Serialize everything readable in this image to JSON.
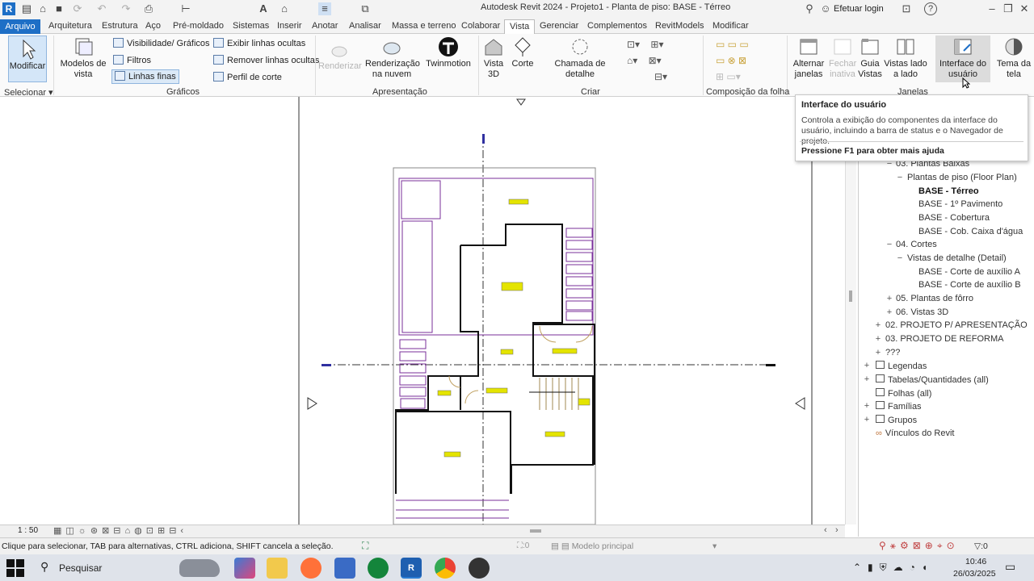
{
  "window": {
    "title": "Autodesk Revit 2024 - Projeto1 - Planta de piso: BASE - Térreo",
    "login": "Efetuar login",
    "help": "?"
  },
  "tabs": [
    "Arquivo",
    "Arquitetura",
    "Estrutura",
    "Aço",
    "Pré-moldado",
    "Sistemas",
    "Inserir",
    "Anotar",
    "Analisar",
    "Massa e terreno",
    "Colaborar",
    "Vista",
    "Gerenciar",
    "Complementos",
    "RevitModels",
    "Modificar"
  ],
  "ribbon": {
    "modify": "Modificar",
    "view_templates": "Modelos de vista",
    "visibility": "Visibilidade/ Gráficos",
    "filters": "Filtros",
    "thin_lines": "Linhas finas",
    "show_hidden": "Exibir linhas ocultas",
    "remove_hidden": "Remover linhas ocultas",
    "cut_profile": "Perfil de corte",
    "render": "Renderizar",
    "cloud_render": "Renderização na nuvem",
    "twinmotion": "Twinmotion",
    "view3d": "Vista 3D",
    "section": "Corte",
    "detail_callout": "Chamada de detalhe",
    "switch_windows": "Alternar janelas",
    "close_inactive": "Fechar inativa",
    "tab_views": "Guia Vistas",
    "tile_views": "Vistas lado a lado",
    "user_interface": "Interface do usuário",
    "screen_theme": "Tema da tela",
    "panels": {
      "select": "Selecionar",
      "graphics": "Gráficos",
      "presentation": "Apresentação",
      "create": "Criar",
      "sheet_composition": "Composição da folha",
      "windows": "Janelas"
    }
  },
  "tooltip": {
    "title": "Interface do usuário",
    "body": "Controla a exibição do componentes da interface do usuário, incluindo a barra de status e o Navegador de projeto.",
    "help": "Pressione F1 para obter mais ajuda"
  },
  "browser": {
    "items": [
      {
        "label": "03. Plantas Baixas",
        "toggle": "−"
      },
      {
        "label": "Plantas de piso (Floor Plan)",
        "toggle": "−"
      },
      {
        "label": "BASE - Térreo",
        "toggle": ""
      },
      {
        "label": "BASE - 1º Pavimento",
        "toggle": ""
      },
      {
        "label": "BASE - Cobertura",
        "toggle": ""
      },
      {
        "label": "BASE - Cob. Caixa d'água",
        "toggle": ""
      },
      {
        "label": "04. Cortes",
        "toggle": "−"
      },
      {
        "label": "Vistas de detalhe (Detail)",
        "toggle": "−"
      },
      {
        "label": "BASE - Corte de auxílio A",
        "toggle": ""
      },
      {
        "label": "BASE - Corte de auxílio B",
        "toggle": ""
      },
      {
        "label": "05. Plantas de fôrro",
        "toggle": "+"
      },
      {
        "label": "06. Vistas 3D",
        "toggle": "+"
      },
      {
        "label": "02. PROJETO P/ APRESENTAÇÃO",
        "toggle": "+"
      },
      {
        "label": "03. PROJETO DE REFORMA",
        "toggle": "+"
      },
      {
        "label": "???",
        "toggle": "+"
      },
      {
        "label": "Legendas",
        "toggle": "+"
      },
      {
        "label": "Tabelas/Quantidades (all)",
        "toggle": "+"
      },
      {
        "label": "Folhas (all)",
        "toggle": ""
      },
      {
        "label": "Famílias",
        "toggle": "+"
      },
      {
        "label": "Grupos",
        "toggle": "+"
      },
      {
        "label": "Vínculos do Revit",
        "toggle": ""
      }
    ]
  },
  "viewbar": {
    "scale": "1 : 50"
  },
  "status": {
    "message": "Clique para selecionar, TAB para alternativas, CTRL adiciona, SHIFT cancela a seleção.",
    "workset": ":0",
    "model": "Modelo principal",
    "filter_count": ":0"
  },
  "taskbar": {
    "search": "Pesquisar",
    "time": "10:46",
    "date": "26/03/2025"
  },
  "colors": {
    "accent": "#1e6fc6",
    "plan_purple": "#7a2f9a",
    "label_yellow": "#d8d800"
  }
}
